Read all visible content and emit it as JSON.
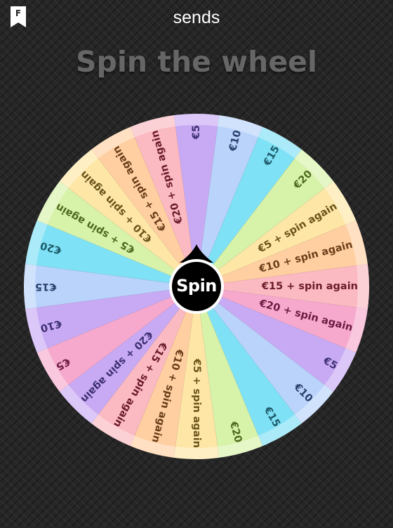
{
  "header": {
    "app_name": "sends",
    "bookmark_icon_letter": "F"
  },
  "title": "Spin the wheel",
  "wheel": {
    "spin_label": "Spin",
    "segments": [
      {
        "label": "€5",
        "color": "#c8aaf4",
        "text_color": "#3d2f70"
      },
      {
        "label": "€10",
        "color": "#b9d3fb",
        "text_color": "#2b3f6c"
      },
      {
        "label": "€15",
        "color": "#7fe1f6",
        "text_color": "#1c5a69"
      },
      {
        "label": "€20",
        "color": "#d7f2a9",
        "text_color": "#4d6a1e"
      },
      {
        "label": "€5 + spin again",
        "color": "#fde6a6",
        "text_color": "#6b541b"
      },
      {
        "label": "€10 + spin again",
        "color": "#ffcfa1",
        "text_color": "#6a3e1a"
      },
      {
        "label": "€15 + spin again",
        "color": "#fbb9c1",
        "text_color": "#6b1c2c"
      },
      {
        "label": "€20 + spin again",
        "color": "#f6a9cd",
        "text_color": "#6d1a42"
      },
      {
        "label": "€5",
        "color": "#c8aaf4",
        "text_color": "#3d2f70"
      },
      {
        "label": "€10",
        "color": "#b9d3fb",
        "text_color": "#2b3f6c"
      },
      {
        "label": "€15",
        "color": "#7fe1f6",
        "text_color": "#1c5a69"
      },
      {
        "label": "€20",
        "color": "#d7f2a9",
        "text_color": "#4d6a1e"
      },
      {
        "label": "€5 + spin again",
        "color": "#fde6a6",
        "text_color": "#6b541b"
      },
      {
        "label": "€10 + spin again",
        "color": "#ffcfa1",
        "text_color": "#6a3e1a"
      },
      {
        "label": "€15 + spin again",
        "color": "#fbb9c1",
        "text_color": "#6b1c2c"
      },
      {
        "label": "€20 + spin again",
        "color": "#c8aaf4",
        "text_color": "#3d2f70"
      },
      {
        "label": "€5",
        "color": "#f6a9cd",
        "text_color": "#6d1a42"
      },
      {
        "label": "€10",
        "color": "#c8aaf4",
        "text_color": "#3d2f70"
      },
      {
        "label": "€15",
        "color": "#b9d3fb",
        "text_color": "#2b3f6c"
      },
      {
        "label": "€20",
        "color": "#7fe1f6",
        "text_color": "#1c5a69"
      },
      {
        "label": "€5 + spin again",
        "color": "#d7f2a9",
        "text_color": "#4d6a1e"
      },
      {
        "label": "€10 + spin again",
        "color": "#fde6a6",
        "text_color": "#6b541b"
      },
      {
        "label": "€15 + spin again",
        "color": "#ffcfa1",
        "text_color": "#6a3e1a"
      },
      {
        "label": "€20 + spin again",
        "color": "#fbb9c1",
        "text_color": "#6b1c2c"
      }
    ],
    "pointer_color": "#000000"
  }
}
